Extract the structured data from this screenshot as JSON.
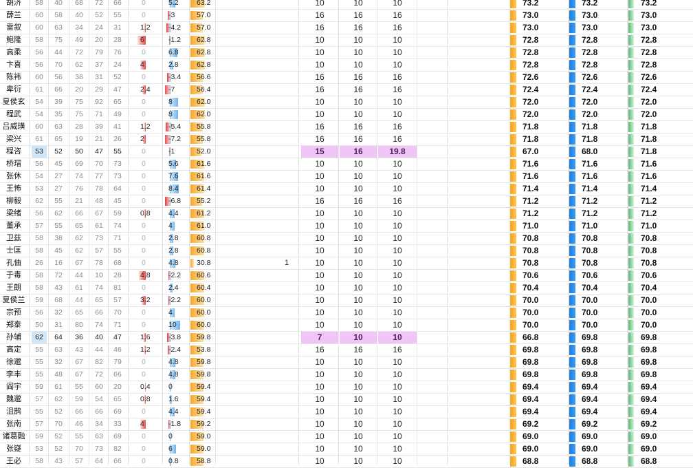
{
  "rows": [
    {
      "name": "胡济",
      "stats": [
        58,
        40,
        68,
        72,
        66
      ],
      "bonus": "0",
      "diff": "5.2",
      "base": "63.2",
      "extra": "",
      "n1": "10",
      "n2": "10",
      "n3": "10",
      "f1": "73.2",
      "f2": "73.2",
      "f3": "73.2"
    },
    {
      "name": "薛兰",
      "stats": [
        60,
        58,
        40,
        52,
        55
      ],
      "bonus": "0",
      "diff": "-3",
      "base": "57.0",
      "extra": "",
      "n1": "16",
      "n2": "16",
      "n3": "16",
      "f1": "73.0",
      "f2": "73.0",
      "f3": "73.0"
    },
    {
      "name": "雷叙",
      "stats": [
        60,
        63,
        34,
        24,
        31
      ],
      "bonus": "1.2",
      "diff": "-4.2",
      "base": "57.0",
      "extra": "",
      "n1": "16",
      "n2": "16",
      "n3": "16",
      "f1": "73.0",
      "f2": "73.0",
      "f3": "73.0"
    },
    {
      "name": "鲍隆",
      "stats": [
        58,
        75,
        49,
        20,
        28
      ],
      "bonus": "6",
      "diff": "-1.2",
      "base": "62.8",
      "extra": "",
      "n1": "10",
      "n2": "10",
      "n3": "10",
      "f1": "72.8",
      "f2": "72.8",
      "f3": "72.8"
    },
    {
      "name": "高柔",
      "stats": [
        56,
        44,
        72,
        79,
        76
      ],
      "bonus": "0",
      "diff": "6.8",
      "base": "62.8",
      "extra": "",
      "n1": "10",
      "n2": "10",
      "n3": "10",
      "f1": "72.8",
      "f2": "72.8",
      "f3": "72.8"
    },
    {
      "name": "卞喜",
      "stats": [
        56,
        70,
        62,
        37,
        24
      ],
      "bonus": "4",
      "diff": "2.8",
      "base": "62.8",
      "extra": "",
      "n1": "10",
      "n2": "10",
      "n3": "10",
      "f1": "72.8",
      "f2": "72.8",
      "f3": "72.8"
    },
    {
      "name": "陈袆",
      "stats": [
        60,
        56,
        38,
        31,
        52
      ],
      "bonus": "0",
      "diff": "-3.4",
      "base": "56.6",
      "extra": "",
      "n1": "16",
      "n2": "16",
      "n3": "16",
      "f1": "72.6",
      "f2": "72.6",
      "f3": "72.6"
    },
    {
      "name": "卑衍",
      "stats": [
        61,
        66,
        20,
        29,
        47
      ],
      "bonus": "2.4",
      "diff": "-7",
      "base": "56.4",
      "extra": "",
      "n1": "16",
      "n2": "16",
      "n3": "16",
      "f1": "72.4",
      "f2": "72.4",
      "f3": "72.4"
    },
    {
      "name": "夏侯玄",
      "stats": [
        54,
        39,
        75,
        92,
        65
      ],
      "bonus": "0",
      "diff": "8",
      "base": "62.0",
      "extra": "",
      "n1": "10",
      "n2": "10",
      "n3": "10",
      "f1": "72.0",
      "f2": "72.0",
      "f3": "72.0"
    },
    {
      "name": "程武",
      "stats": [
        54,
        35,
        75,
        71,
        49
      ],
      "bonus": "0",
      "diff": "8",
      "base": "62.0",
      "extra": "",
      "n1": "10",
      "n2": "10",
      "n3": "10",
      "f1": "72.0",
      "f2": "72.0",
      "f3": "72.0"
    },
    {
      "name": "吕威璜",
      "stats": [
        60,
        63,
        28,
        39,
        41
      ],
      "bonus": "1.2",
      "diff": "-5.4",
      "base": "55.8",
      "extra": "",
      "n1": "16",
      "n2": "16",
      "n3": "16",
      "f1": "71.8",
      "f2": "71.8",
      "f3": "71.8"
    },
    {
      "name": "梁兴",
      "stats": [
        61,
        65,
        19,
        21,
        26
      ],
      "bonus": "2",
      "diff": "-7.2",
      "base": "55.8",
      "extra": "",
      "n1": "16",
      "n2": "16",
      "n3": "16",
      "f1": "71.8",
      "f2": "71.8",
      "f3": "71.8"
    },
    {
      "name": "程咨",
      "stats": [
        53,
        52,
        50,
        47,
        55
      ],
      "bonus": "0",
      "diff": "-1",
      "base": "52.0",
      "extra": "",
      "n1": "15",
      "n2": "16",
      "n3": "19.8",
      "f1": "67.0",
      "f2": "68.0",
      "f3": "71.8",
      "hl": true
    },
    {
      "name": "桥瑁",
      "stats": [
        56,
        45,
        69,
        70,
        73
      ],
      "bonus": "0",
      "diff": "5.6",
      "base": "61.6",
      "extra": "",
      "n1": "10",
      "n2": "10",
      "n3": "10",
      "f1": "71.6",
      "f2": "71.6",
      "f3": "71.6"
    },
    {
      "name": "张休",
      "stats": [
        54,
        27,
        74,
        77,
        73
      ],
      "bonus": "0",
      "diff": "7.6",
      "base": "61.6",
      "extra": "",
      "n1": "10",
      "n2": "10",
      "n3": "10",
      "f1": "71.6",
      "f2": "71.6",
      "f3": "71.6"
    },
    {
      "name": "王怖",
      "stats": [
        53,
        27,
        76,
        78,
        64
      ],
      "bonus": "0",
      "diff": "8.4",
      "base": "61.4",
      "extra": "",
      "n1": "10",
      "n2": "10",
      "n3": "10",
      "f1": "71.4",
      "f2": "71.4",
      "f3": "71.4"
    },
    {
      "name": "柳毅",
      "stats": [
        62,
        55,
        21,
        48,
        45
      ],
      "bonus": "0",
      "diff": "-6.8",
      "base": "55.2",
      "extra": "",
      "n1": "16",
      "n2": "16",
      "n3": "16",
      "f1": "71.2",
      "f2": "71.2",
      "f3": "71.2"
    },
    {
      "name": "梁绪",
      "stats": [
        56,
        62,
        66,
        67,
        59
      ],
      "bonus": "0.8",
      "diff": "4.4",
      "base": "61.2",
      "extra": "",
      "n1": "10",
      "n2": "10",
      "n3": "10",
      "f1": "71.2",
      "f2": "71.2",
      "f3": "71.2"
    },
    {
      "name": "董承",
      "stats": [
        57,
        55,
        65,
        61,
        74
      ],
      "bonus": "0",
      "diff": "4",
      "base": "61.0",
      "extra": "",
      "n1": "10",
      "n2": "10",
      "n3": "10",
      "f1": "71.0",
      "f2": "71.0",
      "f3": "71.0"
    },
    {
      "name": "卫兹",
      "stats": [
        58,
        38,
        62,
        73,
        71
      ],
      "bonus": "0",
      "diff": "2.8",
      "base": "60.8",
      "extra": "",
      "n1": "10",
      "n2": "10",
      "n3": "10",
      "f1": "70.8",
      "f2": "70.8",
      "f3": "70.8"
    },
    {
      "name": "士匡",
      "stats": [
        58,
        45,
        62,
        57,
        55
      ],
      "bonus": "0",
      "diff": "2.8",
      "base": "60.8",
      "extra": "",
      "n1": "10",
      "n2": "10",
      "n3": "10",
      "f1": "70.8",
      "f2": "70.8",
      "f3": "70.8"
    },
    {
      "name": "孔伷",
      "stats": [
        26,
        16,
        67,
        78,
        68
      ],
      "bonus": "0",
      "diff": "4.8",
      "base": "30.8",
      "extra": "1",
      "n1": "10",
      "n2": "10",
      "n3": "10",
      "f1": "70.8",
      "f2": "70.8",
      "f3": "70.8"
    },
    {
      "name": "于毒",
      "stats": [
        58,
        72,
        44,
        10,
        28
      ],
      "bonus": "4.8",
      "diff": "-2.2",
      "base": "60.6",
      "extra": "",
      "n1": "10",
      "n2": "10",
      "n3": "10",
      "f1": "70.6",
      "f2": "70.6",
      "f3": "70.6"
    },
    {
      "name": "王朗",
      "stats": [
        58,
        43,
        61,
        74,
        81
      ],
      "bonus": "0",
      "diff": "2.4",
      "base": "60.4",
      "extra": "",
      "n1": "10",
      "n2": "10",
      "n3": "10",
      "f1": "70.4",
      "f2": "70.4",
      "f3": "70.4"
    },
    {
      "name": "夏侯兰",
      "stats": [
        59,
        68,
        44,
        65,
        57
      ],
      "bonus": "3.2",
      "diff": "-2.2",
      "base": "60.0",
      "extra": "",
      "n1": "10",
      "n2": "10",
      "n3": "10",
      "f1": "70.0",
      "f2": "70.0",
      "f3": "70.0"
    },
    {
      "name": "宗预",
      "stats": [
        56,
        32,
        65,
        66,
        70
      ],
      "bonus": "0",
      "diff": "4",
      "base": "60.0",
      "extra": "",
      "n1": "10",
      "n2": "10",
      "n3": "10",
      "f1": "70.0",
      "f2": "70.0",
      "f3": "70.0"
    },
    {
      "name": "郑泰",
      "stats": [
        50,
        31,
        80,
        74,
        71
      ],
      "bonus": "0",
      "diff": "10",
      "base": "60.0",
      "extra": "",
      "n1": "10",
      "n2": "10",
      "n3": "10",
      "f1": "70.0",
      "f2": "70.0",
      "f3": "70.0"
    },
    {
      "name": "孙辅",
      "stats": [
        62,
        64,
        36,
        40,
        47
      ],
      "bonus": "1.6",
      "diff": "-3.8",
      "base": "59.8",
      "extra": "",
      "n1": "7",
      "n2": "10",
      "n3": "10",
      "f1": "66.8",
      "f2": "69.8",
      "f3": "69.8",
      "hl": true
    },
    {
      "name": "高定",
      "stats": [
        55,
        63,
        43,
        44,
        46
      ],
      "bonus": "1.2",
      "diff": "-2.4",
      "base": "53.8",
      "extra": "",
      "n1": "16",
      "n2": "16",
      "n3": "16",
      "f1": "69.8",
      "f2": "69.8",
      "f3": "69.8"
    },
    {
      "name": "徐邈",
      "stats": [
        55,
        32,
        67,
        82,
        79
      ],
      "bonus": "0",
      "diff": "4.8",
      "base": "59.8",
      "extra": "",
      "n1": "10",
      "n2": "10",
      "n3": "10",
      "f1": "69.8",
      "f2": "69.8",
      "f3": "69.8"
    },
    {
      "name": "李丰",
      "stats": [
        55,
        48,
        67,
        72,
        66
      ],
      "bonus": "0",
      "diff": "4.8",
      "base": "59.8",
      "extra": "",
      "n1": "10",
      "n2": "10",
      "n3": "10",
      "f1": "69.8",
      "f2": "69.8",
      "f3": "69.8"
    },
    {
      "name": "阎宇",
      "stats": [
        59,
        61,
        55,
        60,
        20
      ],
      "bonus": "0.4",
      "diff": "0",
      "base": "59.4",
      "extra": "",
      "n1": "10",
      "n2": "10",
      "n3": "10",
      "f1": "69.4",
      "f2": "69.4",
      "f3": "69.4"
    },
    {
      "name": "魏邈",
      "stats": [
        57,
        62,
        59,
        54,
        65
      ],
      "bonus": "0.8",
      "diff": "1.6",
      "base": "59.4",
      "extra": "",
      "n1": "10",
      "n2": "10",
      "n3": "10",
      "f1": "69.4",
      "f2": "69.4",
      "f3": "69.4"
    },
    {
      "name": "沮鹄",
      "stats": [
        55,
        52,
        66,
        66,
        69
      ],
      "bonus": "0",
      "diff": "4.4",
      "base": "59.4",
      "extra": "",
      "n1": "10",
      "n2": "10",
      "n3": "10",
      "f1": "69.4",
      "f2": "69.4",
      "f3": "69.4"
    },
    {
      "name": "张南",
      "stats": [
        57,
        70,
        46,
        34,
        33
      ],
      "bonus": "4",
      "diff": "-1.8",
      "base": "59.2",
      "extra": "",
      "n1": "10",
      "n2": "10",
      "n3": "10",
      "f1": "69.2",
      "f2": "69.2",
      "f3": "69.2"
    },
    {
      "name": "诸葛融",
      "stats": [
        59,
        52,
        55,
        63,
        69
      ],
      "bonus": "0",
      "diff": "0",
      "base": "59.0",
      "extra": "",
      "n1": "10",
      "n2": "10",
      "n3": "10",
      "f1": "69.0",
      "f2": "69.0",
      "f3": "69.0"
    },
    {
      "name": "张嶷",
      "stats": [
        53,
        52,
        70,
        73,
        82
      ],
      "bonus": "0",
      "diff": "6",
      "base": "59.0",
      "extra": "",
      "n1": "10",
      "n2": "10",
      "n3": "10",
      "f1": "69.0",
      "f2": "69.0",
      "f3": "69.0"
    },
    {
      "name": "王必",
      "stats": [
        58,
        43,
        57,
        64,
        66
      ],
      "bonus": "0",
      "diff": "0.8",
      "base": "58.8",
      "extra": "",
      "n1": "10",
      "n2": "10",
      "n3": "10",
      "f1": "68.8",
      "f2": "68.8",
      "f3": "68.8"
    }
  ],
  "colors": {
    "highlight": "#efc6f6",
    "score1": "#f3a11e",
    "score2": "#1a82e6",
    "score3": "#52b86e",
    "negative": "#e23c3c",
    "positive": "#6fb4ec"
  }
}
